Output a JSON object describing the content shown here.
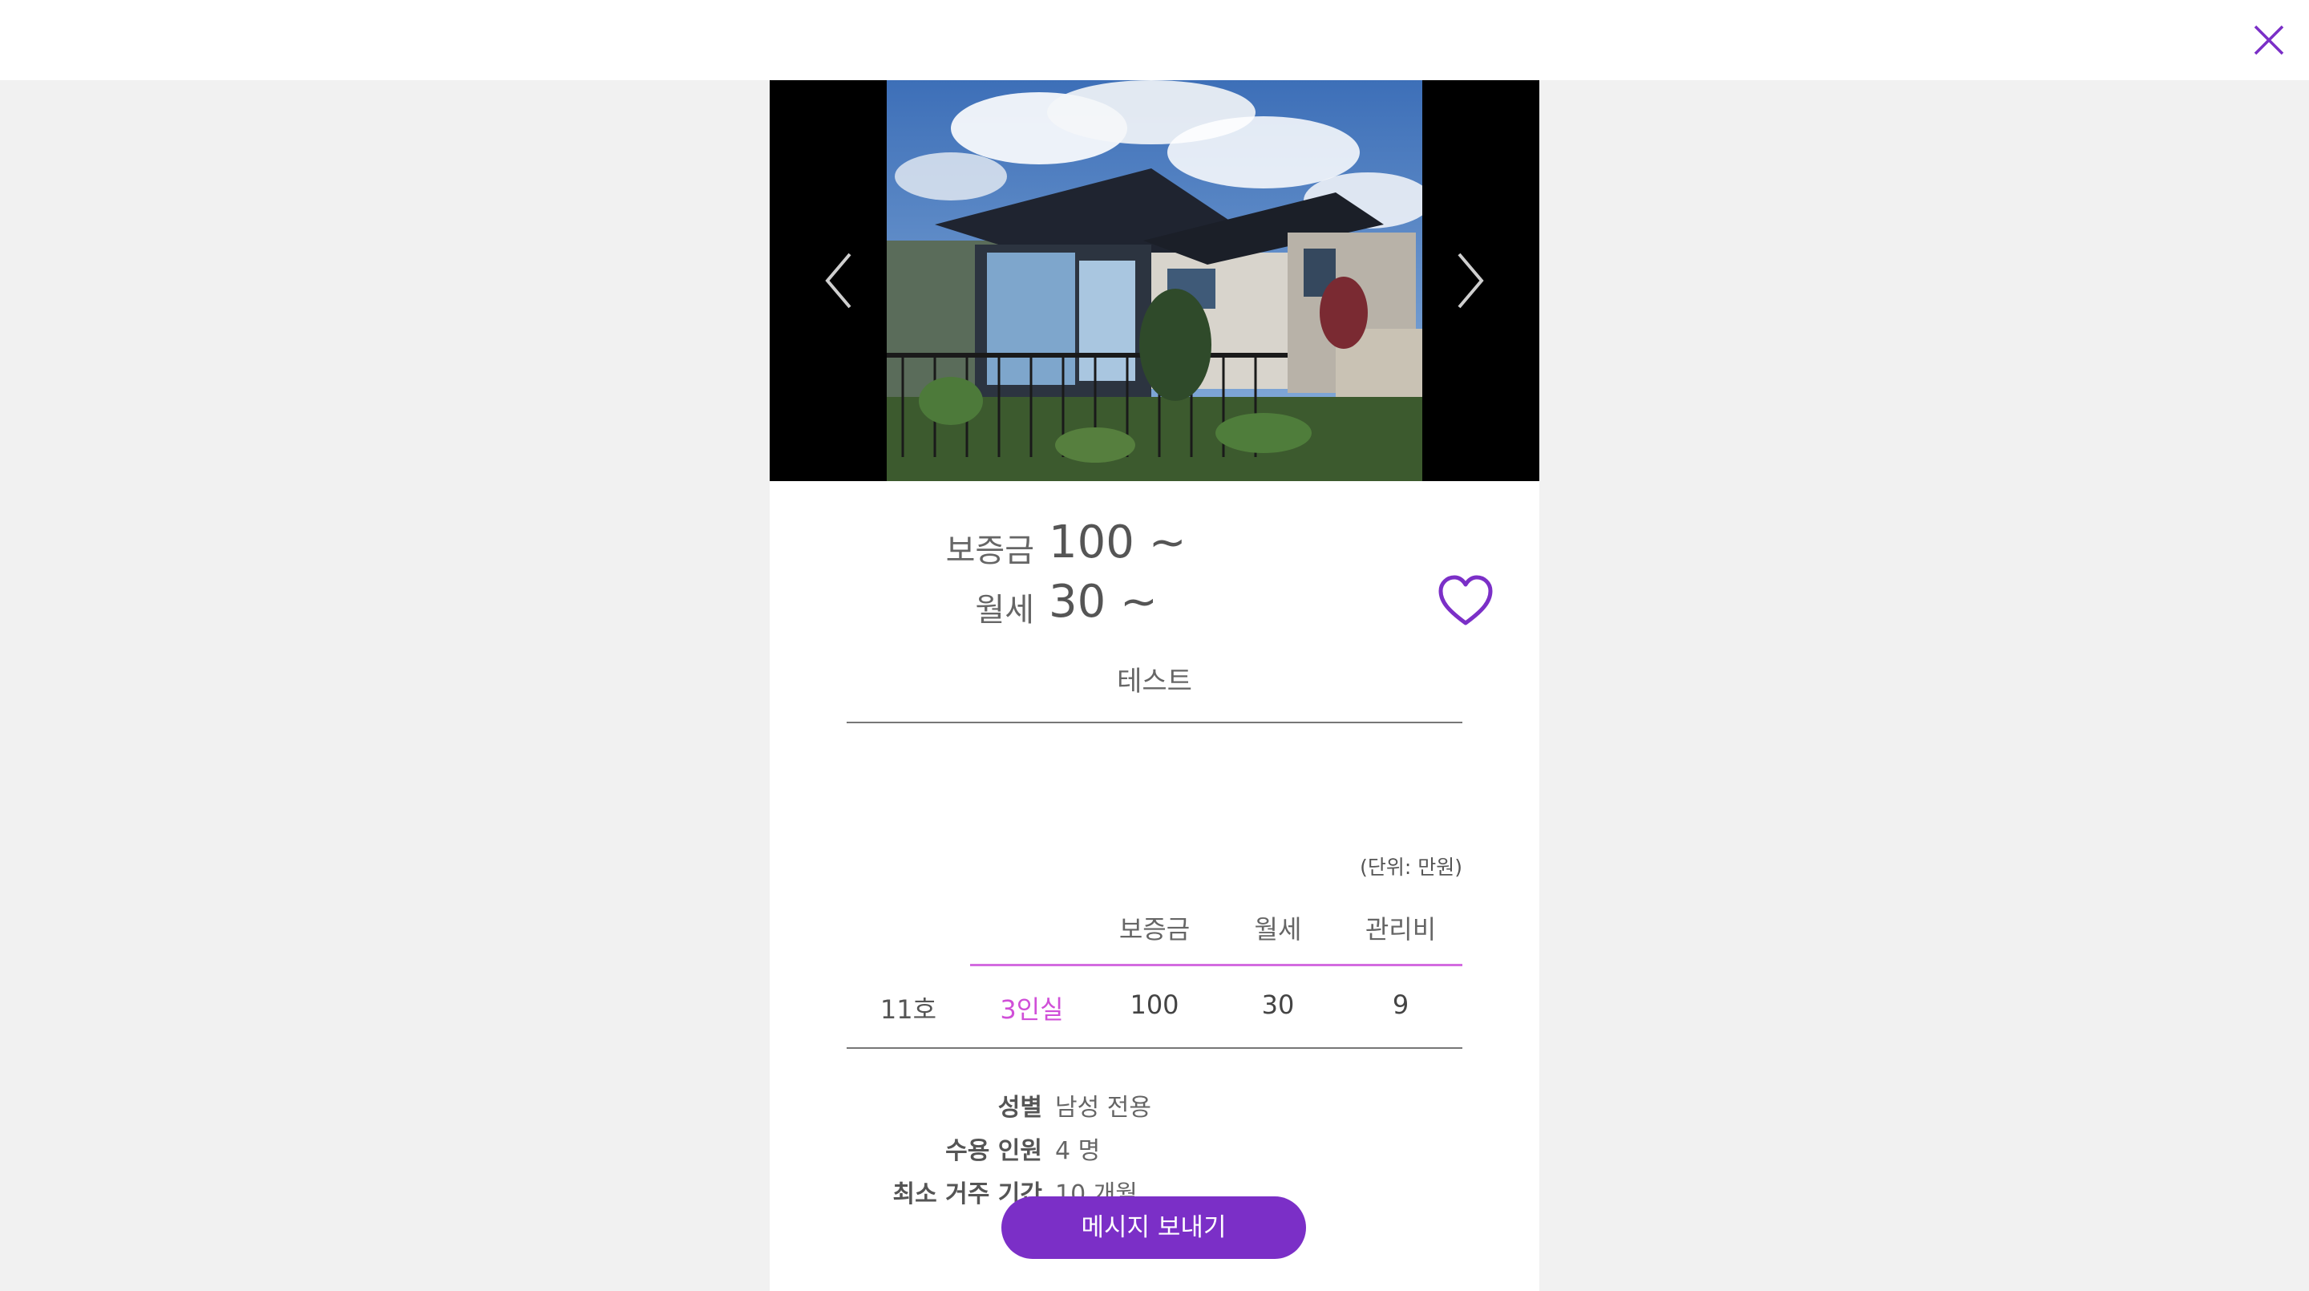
{
  "header": {
    "close_icon": "close-icon",
    "accent_color": "#7b2fc7"
  },
  "listing": {
    "deposit_label": "보증금",
    "deposit_value": "100 ~",
    "rent_label": "월세",
    "rent_value": "30 ~",
    "room_name": "테스트",
    "favorite_icon": "heart-outline-icon"
  },
  "carousel": {
    "prev_icon": "chevron-left-icon",
    "next_icon": "chevron-right-icon"
  },
  "rooms": {
    "unit_note": "(단위: 만원)",
    "columns": [
      "보증금",
      "월세",
      "관리비"
    ],
    "rows": [
      {
        "unit": "11호",
        "type": "3인실",
        "deposit": "100",
        "rent": "30",
        "fee": "9"
      }
    ]
  },
  "info": [
    {
      "key": "성별",
      "value": "남성 전용"
    },
    {
      "key": "수용 인원",
      "value": "4 명"
    },
    {
      "key": "최소 거주 기간",
      "value": "10 개월"
    }
  ],
  "actions": {
    "message_label": "메시지 보내기"
  }
}
